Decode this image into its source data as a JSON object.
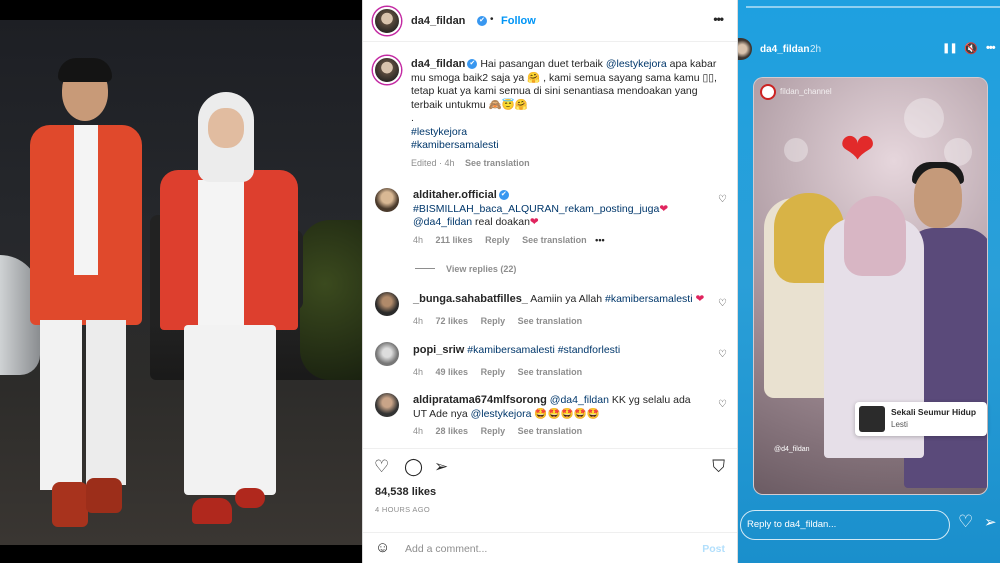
{
  "post": {
    "header": {
      "username": "da4_fildan",
      "verified_mark": "✔",
      "dot": "•",
      "follow": "Follow",
      "more": "•••"
    },
    "caption": {
      "username": "da4_fildan",
      "text_1": "Hai pasangan duet terbaik ",
      "mention": "@lestykejora",
      "text_2": " apa kabar mu smoga baik2 saja ya 🤗 , kami semua sayang sama kamu ▯▯, tetap kuat ya kami semua di sini senantiasa mendoakan yang terbaik untukmu 🙈😇🤗",
      "dot_line": ".",
      "hashtag_1": "#lestykejora",
      "hashtag_2": "#kamibersamalesti",
      "edited": "Edited · 4h",
      "see_translation": "See translation"
    },
    "comments": [
      {
        "username": "alditaher.official",
        "verified": true,
        "text_hash": "#BISMILLAH_baca_ALQURAN_rekam_posting_juga",
        "text_mention": "@da4_fildan",
        "text_rest": " real doakan",
        "emoji": "❤",
        "time": "4h",
        "likes": "211 likes",
        "reply": "Reply",
        "see_translation": "See translation",
        "more": "•••"
      },
      {
        "username": "_bunga.sahabatfilles_",
        "text_plain": "Aamiin ya Allah ",
        "text_hash": "#kamibersamalesti",
        "emoji": "❤",
        "time": "4h",
        "likes": "72 likes",
        "reply": "Reply",
        "see_translation": "See translation"
      },
      {
        "username": "popi_sriw",
        "text_hash": "#kamibersamalesti #standforlesti",
        "time": "4h",
        "likes": "49 likes",
        "reply": "Reply",
        "see_translation": "See translation"
      },
      {
        "username": "aldipratama674mlfsorong",
        "text_mention": "@da4_fildan",
        "text_plain": " KK yg selalu ada UT Ade nya ",
        "text_mention_2": "@lestykejora",
        "emoji": " 🤩🤩🤩🤩🤩",
        "time": "4h",
        "likes": "28 likes",
        "reply": "Reply",
        "see_translation": "See translation"
      }
    ],
    "view_replies": "View replies (22)",
    "likes": "84,538 likes",
    "time_ago": "4 HOURS AGO",
    "add_comment_placeholder": "Add a comment...",
    "post_button": "Post",
    "icons": {
      "heart": "♡",
      "comment": "◯",
      "share": "➢",
      "save": "⛉",
      "emoji": "☺"
    }
  },
  "story": {
    "username": "da4_fildan",
    "time": "2h",
    "inner_label": "fildan_channel",
    "inner_sub": "@d4_fildan",
    "music_title": "Sekali Seumur Hidup",
    "music_artist": "Lesti",
    "reply_placeholder": "Reply to da4_fildan...",
    "icons": {
      "pause": "❚❚",
      "mute": "🔇",
      "more": "•••",
      "heart": "♡",
      "send": "➢"
    }
  },
  "colors": {
    "link": "#00376b",
    "follow": "#0095f6",
    "verified": "#3897f0",
    "story_bg": "#1ea0e0"
  }
}
